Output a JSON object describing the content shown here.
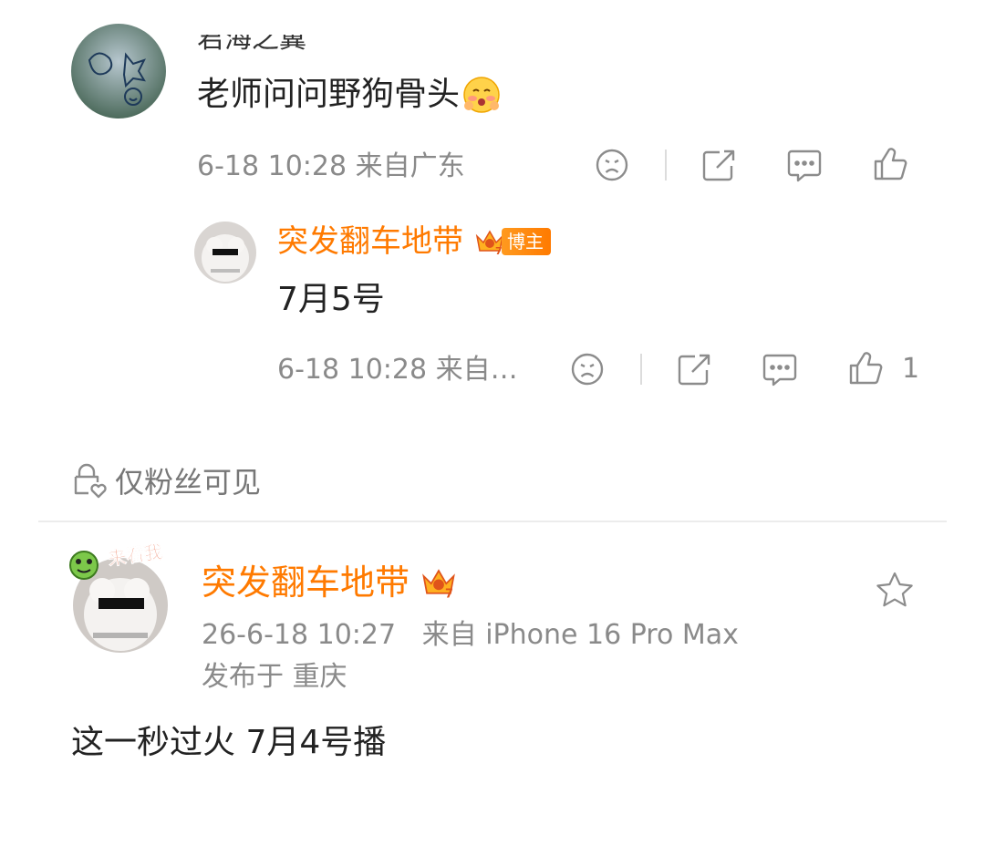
{
  "comment1": {
    "user_name_partial": "君海之翼",
    "text": "老师问问野狗骨头",
    "meta": "6-18 10:28 来自广东",
    "icons": [
      "sad-face-icon",
      "share-icon",
      "comment-icon",
      "like-icon"
    ]
  },
  "reply1": {
    "user_name": "突发翻车地带",
    "badge_label": "博主",
    "badge_level": "7",
    "text": "7月5号",
    "meta": "6-18 10:28 来自…",
    "like_count": "1"
  },
  "visibility": {
    "label": "仅粉丝可见"
  },
  "post": {
    "user_name": "突发翻车地带",
    "badge_level": "7",
    "avatar_sticker": "来看我",
    "time_source": "26-6-18 10:27   来自 iPhone 16 Pro Max",
    "location": "发布于 重庆",
    "text": "这一秒过火 7月4号播"
  },
  "colors": {
    "accent": "#ff7a00",
    "meta_gray": "#8a8a8a",
    "icon_gray": "#8c8c8c",
    "divider": "#ececec"
  }
}
